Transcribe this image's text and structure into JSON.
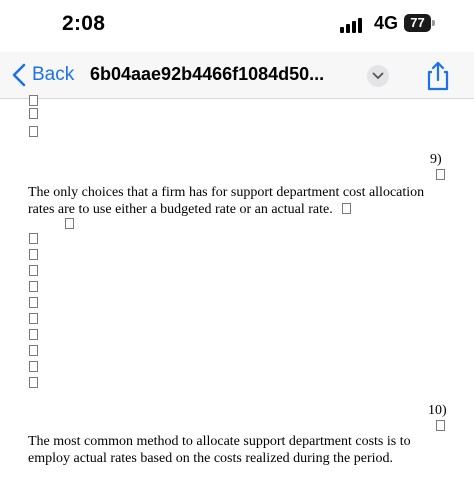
{
  "status_bar": {
    "time": "2:08",
    "network": "4G",
    "battery": "77"
  },
  "nav": {
    "back_label": "Back",
    "title": "6b04aae92b4466f1084d50...",
    "accent_color": "#1a73e8",
    "icons": [
      "chevron-left-icon",
      "chevron-down-icon",
      "share-icon"
    ]
  },
  "document": {
    "questions": [
      {
        "number": "9)",
        "text_line1": "The only choices that a firm has for support department cost allocation",
        "text_line2": "rates are to use either a budgeted rate or an actual rate."
      },
      {
        "number": "10)",
        "text_line1": "The most common method to allocate support department costs is to",
        "text_line2": "employ actual rates based on the costs realized during the period."
      }
    ],
    "placeholder_glyph": "empty-box-icon"
  }
}
